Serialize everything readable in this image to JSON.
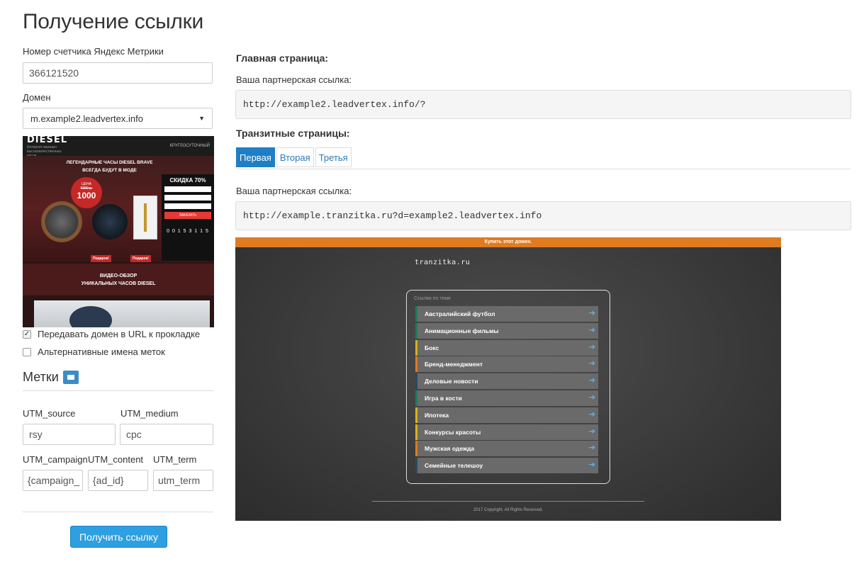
{
  "page_title": "Получение ссылки",
  "form": {
    "counter_label": "Номер счетчика Яндекс Метрики",
    "counter_value": "366121520",
    "domain_label": "Домен",
    "domain_value": "m.example2.leadvertex.info",
    "checkbox_pass_domain": "Передавать домен в URL к прокладке",
    "checkbox_pass_domain_checked": true,
    "checkbox_alt_names": "Альтернативные имена меток",
    "checkbox_alt_names_checked": false
  },
  "preview_left": {
    "logo": "DIESEL",
    "sub": "Интернет-магазин высококачественных часов",
    "top_right": "КРУГЛОСУТОЧНЫЙ",
    "title_line1": "ЛЕГЕНДАРНЫЕ ЧАСЫ DIESEL BRAVE",
    "title_line2": "ВСЕГДА БУДУТ В МОДЕ",
    "price_label": "ЦЕНА",
    "old_price": "6300 р.",
    "price": "1000",
    "discount": "СКИДКА 70%",
    "order_button": "ЗАКАЗАТЬ",
    "timer": "0 0 1 5 3 1 1 5",
    "gift": "Подарок!",
    "video_line1": "ВИДЕО-ОБЗОР",
    "video_line2": "УНИКАЛЬНЫХ ЧАСОВ DIESEL"
  },
  "labels_section": {
    "title": "Метки",
    "utm_source_label": "UTM_source",
    "utm_source_value": "rsy",
    "utm_medium_label": "UTM_medium",
    "utm_medium_value": "cpc",
    "utm_campaign_label": "UTM_campaign",
    "utm_campaign_value": "{campaign_",
    "utm_content_label": "UTM_content",
    "utm_content_value": "{ad_id}",
    "utm_term_label": "UTM_term",
    "utm_term_value": "utm_term"
  },
  "submit_button": "Получить ссылку",
  "main_page": {
    "title": "Главная страница:",
    "link_label": "Ваша партнерская ссылка:",
    "link": "http://example2.leadvertex.info/?"
  },
  "transit_pages": {
    "title": "Транзитные страницы:",
    "tabs": [
      "Первая",
      "Вторая",
      "Третья"
    ],
    "active_tab": 0,
    "link_label": "Ваша партнерская ссылка:",
    "link": "http://example.tranzitka.ru?d=example2.leadvertex.info"
  },
  "preview_right": {
    "bar": "Купить этот домен.",
    "logo": "tranzitka.ru",
    "box_title": "Ссылки по теме",
    "items": [
      {
        "label": "Австралийский футбол",
        "color": "#1d7a5a"
      },
      {
        "label": "Анимационные фильмы",
        "color": "#1d7a5a"
      },
      {
        "label": "Бокс",
        "color": "#d6b21e"
      },
      {
        "label": "Бренд-менеджмент",
        "color": "#e07b20"
      },
      {
        "label": "Деловые новости",
        "color": "#2a4a5e"
      },
      {
        "label": "Игра в кости",
        "color": "#1d7a5a"
      },
      {
        "label": "Ипотека",
        "color": "#d6b21e"
      },
      {
        "label": "Конкурсы красоты",
        "color": "#d6b21e"
      },
      {
        "label": "Мужская одежда",
        "color": "#e07b20"
      },
      {
        "label": "Семейные телешоу",
        "color": "#2a4a5e"
      }
    ],
    "copyright": "2017 Copyright. All Rights Reserved."
  }
}
